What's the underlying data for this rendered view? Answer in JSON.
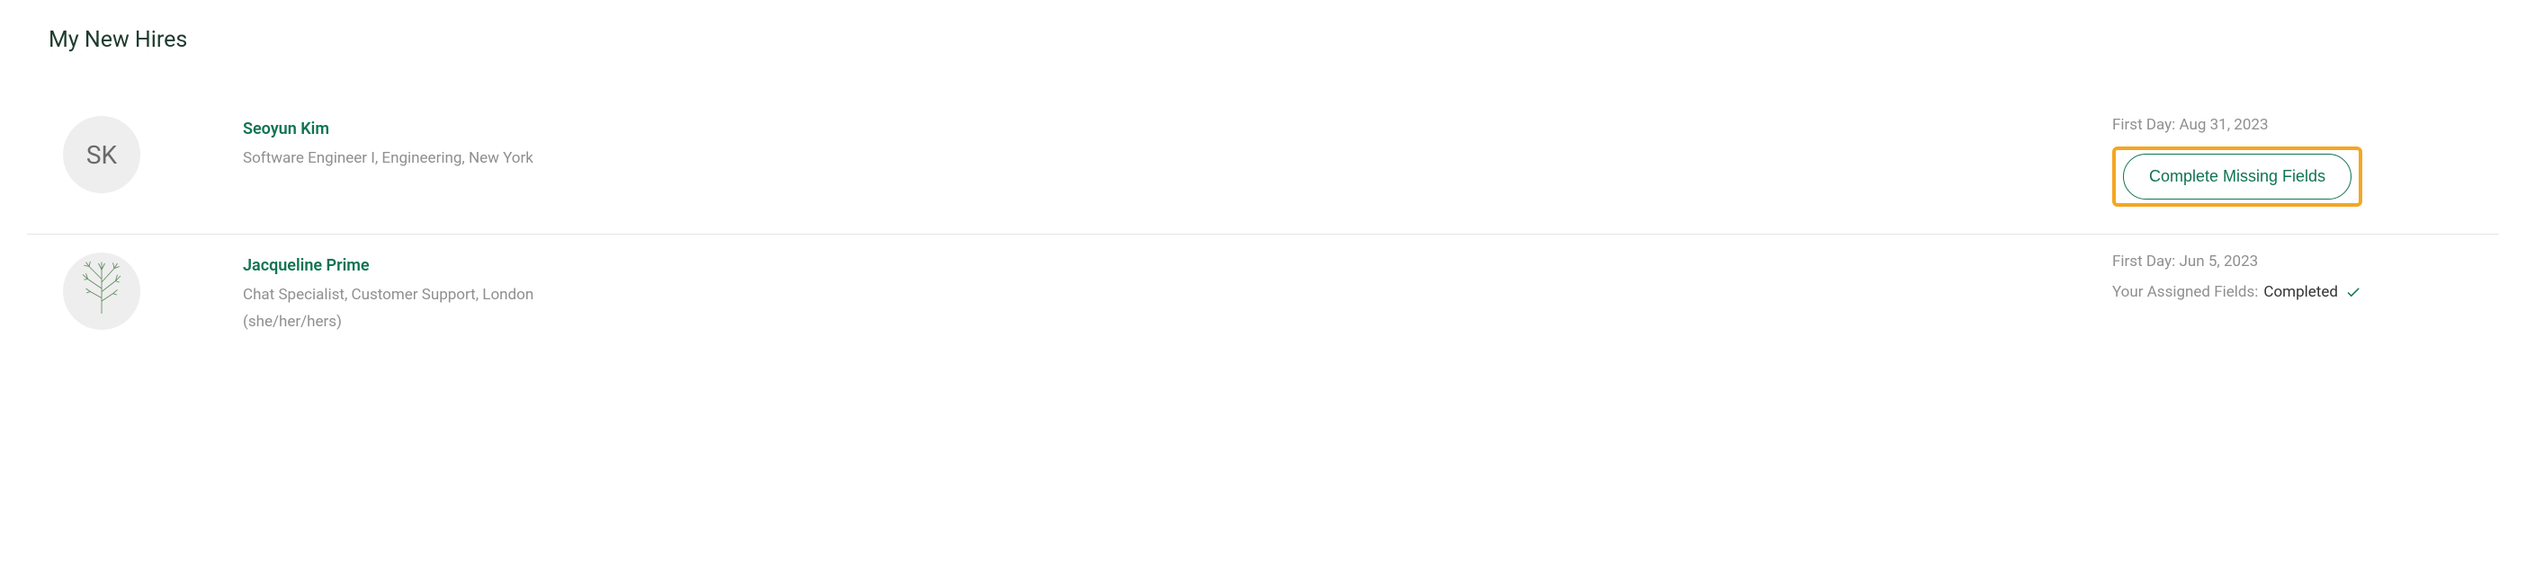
{
  "section_title": "My New Hires",
  "hires": [
    {
      "initials": "SK",
      "avatar_type": "initials",
      "name": "Seoyun Kim",
      "detail": "Software Engineer I, Engineering, New York",
      "pronouns": "",
      "first_day_label": "First Day: Aug 31, 2023",
      "action_label": "Complete Missing Fields",
      "status_prefix": "",
      "status_value": "",
      "highlighted": true
    },
    {
      "initials": "",
      "avatar_type": "botanical",
      "name": "Jacqueline Prime",
      "detail": "Chat Specialist, Customer Support, London",
      "pronouns": "(she/her/hers)",
      "first_day_label": "First Day: Jun 5, 2023",
      "action_label": "",
      "status_prefix": "Your Assigned Fields:",
      "status_value": "Completed",
      "highlighted": false
    }
  ]
}
